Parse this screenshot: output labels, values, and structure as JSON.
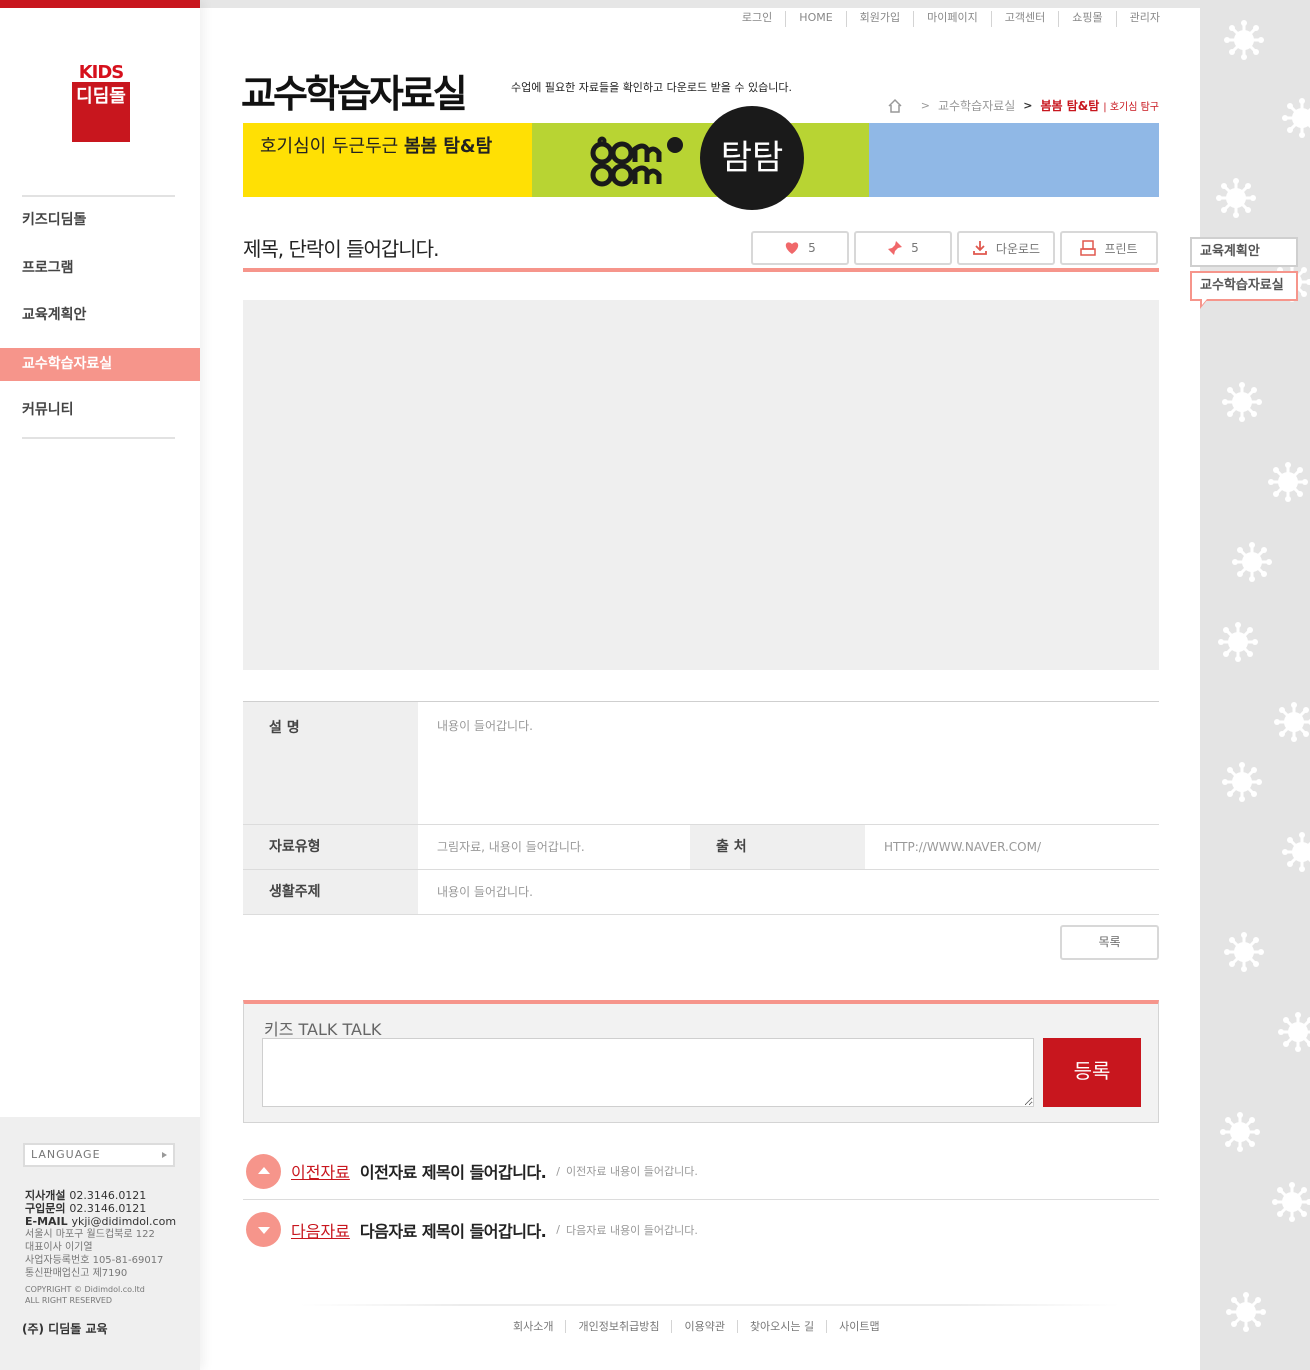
{
  "util_nav": [
    "로그인",
    "HOME",
    "회원가입",
    "마이페이지",
    "고객센터",
    "쇼핑몰",
    "관리자"
  ],
  "logo": {
    "kids": "KIDS",
    "word": "디딤돌"
  },
  "sidebar": {
    "items": [
      {
        "label": "키즈디딤돌"
      },
      {
        "label": "프로그램"
      },
      {
        "label": "교육계획안"
      },
      {
        "label": "교수학습자료실"
      },
      {
        "label": "커뮤니티"
      }
    ],
    "active_index": 3,
    "language_label": "LANGUAGE",
    "contact": {
      "branch_label": "지사개설",
      "branch_phone": "02.3146.0121",
      "buy_label": "구입문의",
      "buy_phone": "02.3146.0121",
      "email_label": "E-MAIL",
      "email": "ykji@didimdol.com",
      "address": "서울시 마포구 월드컵북로 122",
      "ceo": "대표이사 이기열",
      "biz_no": "사업자등록번호 105-81-69017",
      "mail_order": "통신판매업신고 제7190",
      "copyright": "COPYRIGHT © Didimdol.co.ltd",
      "rights": "ALL RIGHT RESERVED"
    },
    "company": "(주) 디딤돌 교육"
  },
  "header": {
    "title": "교수학습자료실",
    "description": "수업에 필요한 자료들을 확인하고 다운로드 받을 수 있습니다.",
    "breadcrumb": [
      "교수학습자료실",
      "봄봄 탐&탐"
    ],
    "breadcrumb_sub": "| 호기심 탐구"
  },
  "banner": {
    "tagline_prefix": "호기심이 두근두근",
    "tagline_bold": "봄봄 탐&탐",
    "badge": "탐탐",
    "colors": {
      "yellow": "#ffe004",
      "green": "#b8d433",
      "blue": "#90b8e6"
    }
  },
  "post": {
    "title": "제목, 단락이 들어갑니다.",
    "like_count": "5",
    "pin_count": "5",
    "download_label": "다운로드",
    "print_label": "프린트"
  },
  "info": {
    "desc_label": "설 명",
    "desc_value": "내용이 들어갑니다.",
    "type_label": "자료유형",
    "type_value": "그림자료, 내용이 들어갑니다.",
    "source_label": "출 처",
    "source_value": "HTTP://WWW.NAVER.COM/",
    "theme_label": "생활주제",
    "theme_value": "내용이 들어갑니다."
  },
  "list_button": "목록",
  "talk": {
    "title": "키즈 TALK TALK",
    "submit": "등록"
  },
  "prev": {
    "label": "이전자료",
    "title": "이전자료 제목이 들어갑니다.",
    "slash": "/",
    "desc": "이전자료 내용이 들어갑니다."
  },
  "next": {
    "label": "다음자료",
    "title": "다음자료 제목이 들어갑니다.",
    "slash": "/",
    "desc": "다음자료 내용이 들어갑니다."
  },
  "footer_links": [
    "회사소개",
    "개인정보취급방침",
    "이용약관",
    "찾아오시는 길",
    "사이트맵"
  ],
  "quick_tabs": [
    "교육계획안",
    "교수학습자료실"
  ],
  "colors": {
    "brand_red": "#c8161e",
    "accent_pink": "#f6958b"
  }
}
